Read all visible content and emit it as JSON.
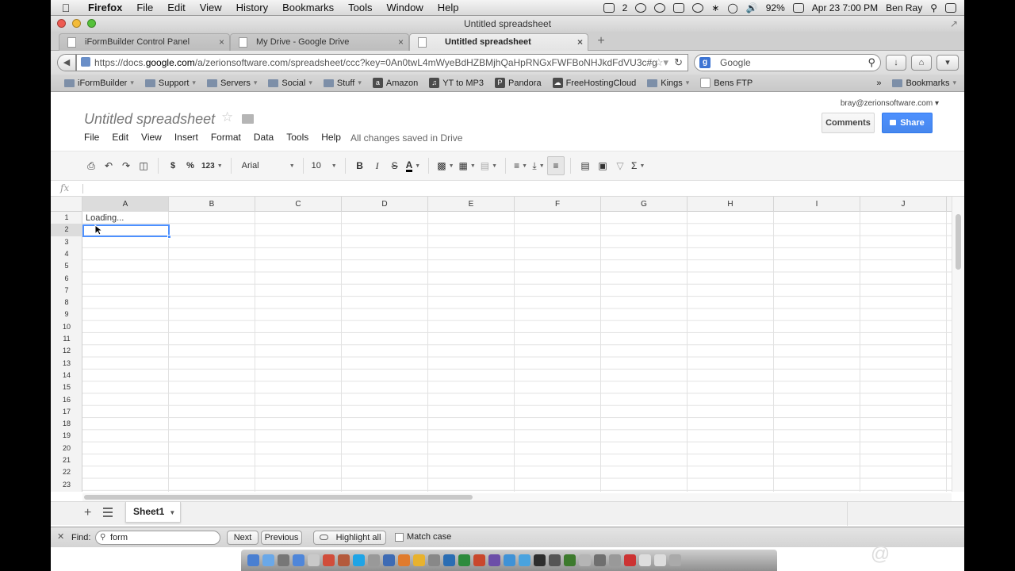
{
  "menubar": {
    "app_name": "Firefox",
    "items": [
      "File",
      "Edit",
      "View",
      "History",
      "Bookmarks",
      "Tools",
      "Window",
      "Help"
    ],
    "status_count": "2",
    "battery": "92%",
    "clock": "Apr 23  7:00 PM",
    "user": "Ben Ray"
  },
  "window": {
    "title": "Untitled spreadsheet"
  },
  "tabs": [
    {
      "label": "iFormBuilder Control Panel"
    },
    {
      "label": "My Drive - Google Drive"
    },
    {
      "label": "Untitled spreadsheet"
    }
  ],
  "navbar": {
    "url_scheme": "https://docs.",
    "url_host": "google.com",
    "url_path": "/a/zerionsoftware.com/spreadsheet/ccc?key=0An0twL4mWyeBdHZBMjhQaHpRNGxFWFBoNHJkdFdVU3c#g",
    "search_placeholder": "Google"
  },
  "bookmarks": {
    "items": [
      "iFormBuilder",
      "Support",
      "Servers",
      "Social",
      "Stuff",
      "Amazon",
      "YT to MP3",
      "Pandora",
      "FreeHostingCloud",
      "Kings",
      "Bens FTP"
    ],
    "overflow": "»",
    "bookmarks_label": "Bookmarks"
  },
  "docs": {
    "title": "Untitled spreadsheet",
    "account": "bray@zerionsoftware.com",
    "comments_label": "Comments",
    "share_label": "Share",
    "menu": [
      "File",
      "Edit",
      "View",
      "Insert",
      "Format",
      "Data",
      "Tools",
      "Help"
    ],
    "save_status": "All changes saved in Drive"
  },
  "toolbar": {
    "currency": "$",
    "percent": "%",
    "number_format": "123",
    "font": "Arial",
    "font_size": "10",
    "bold": "B",
    "italic": "I",
    "strike": "S",
    "text_color": "A",
    "functions": "Σ"
  },
  "formula_bar": {
    "label": "fx"
  },
  "grid": {
    "columns": [
      "A",
      "B",
      "C",
      "D",
      "E",
      "F",
      "G",
      "H",
      "I",
      "J"
    ],
    "rows": [
      "1",
      "2",
      "3",
      "4",
      "5",
      "6",
      "7",
      "8",
      "9",
      "10",
      "11",
      "12",
      "13",
      "14",
      "15",
      "16",
      "17",
      "18",
      "19",
      "20",
      "21",
      "22",
      "23"
    ],
    "cell_a1": "Loading...",
    "selected_column": "A",
    "selected_row": "2"
  },
  "sheets": {
    "tabs": [
      "Sheet1"
    ]
  },
  "findbar": {
    "label": "Find:",
    "query": "form",
    "next": "Next",
    "previous": "Previous",
    "highlight_all": "Highlight all",
    "match_case": "Match case"
  },
  "colors": {
    "share_blue": "#4d90fe",
    "selection_blue": "#4d90fe",
    "header_gray": "#f3f3f3"
  }
}
